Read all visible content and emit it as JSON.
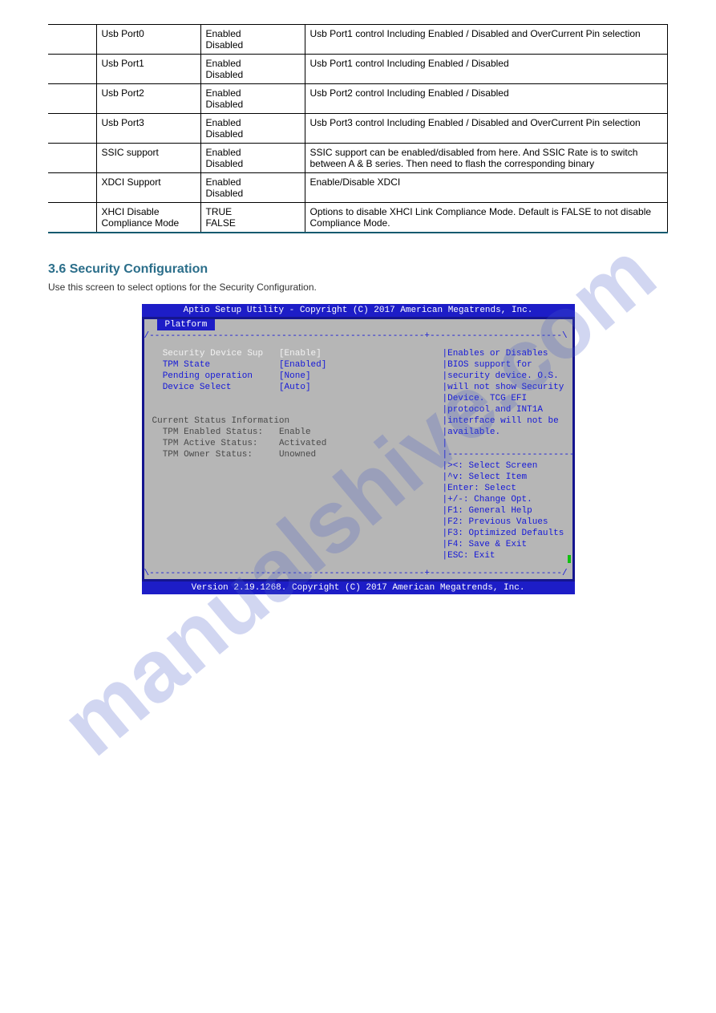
{
  "watermark": "manualshive.com",
  "table": {
    "rows": [
      {
        "c1": "",
        "c2": "Usb Port0",
        "c3": "Enabled\nDisabled",
        "c4": "Usb Port1 control Including Enabled / Disabled and OverCurrent Pin selection"
      },
      {
        "c1": "",
        "c2": "Usb Port1",
        "c3": "Enabled\nDisabled",
        "c4": "Usb Port1 control Including Enabled / Disabled"
      },
      {
        "c1": "",
        "c2": "Usb Port2",
        "c3": "Enabled\nDisabled",
        "c4": "Usb Port2 control Including Enabled / Disabled"
      },
      {
        "c1": "",
        "c2": "Usb Port3",
        "c3": "Enabled\nDisabled",
        "c4": "Usb Port3 control Including Enabled / Disabled and OverCurrent Pin selection"
      },
      {
        "c1": "",
        "c2": "SSIC support",
        "c3": "Enabled\nDisabled",
        "c4": "SSIC support can be enabled/disabled from here. And SSIC Rate is to switch between A & B series. Then need to flash the corresponding binary"
      },
      {
        "c1": "",
        "c2": "XDCI Support",
        "c3": "Enabled\nDisabled",
        "c4": "Enable/Disable XDCI"
      },
      {
        "c1": "",
        "c2": "XHCI Disable Compliance Mode",
        "c3": "TRUE\nFALSE",
        "c4": "Options to disable XHCI Link Compliance Mode. Default is FALSE to not disable Compliance Mode."
      }
    ]
  },
  "heading": "3.6 Security Configuration",
  "subtext": "Use this screen to select options for the Security Configuration.",
  "bios": {
    "header": "Aptio Setup Utility - Copyright (C) 2017 American Megatrends, Inc.",
    "tab": "Platform",
    "footer": "Version 2.19.1268. Copyright (C) 2017 American Megatrends, Inc.",
    "left_options": [
      {
        "label": "Security Device Sup",
        "value": "[Enable]",
        "class": "white"
      },
      {
        "label": "TPM State",
        "value": "[Enabled]",
        "class": "blue"
      },
      {
        "label": "Pending operation",
        "value": "[None]",
        "class": "blue"
      },
      {
        "label": "Device Select",
        "value": "[Auto]",
        "class": "blue"
      }
    ],
    "status_heading": "Current Status Information",
    "status": [
      {
        "label": "TPM Enabled Status:",
        "value": "Enable"
      },
      {
        "label": "TPM Active Status:",
        "value": "Activated"
      },
      {
        "label": "TPM Owner Status:",
        "value": "Unowned"
      }
    ],
    "help": [
      "Enables or Disables",
      "BIOS support for",
      "security device. O.S.",
      "will not show Security",
      "Device. TCG EFI",
      "protocol and INT1A",
      "interface will not be",
      "available."
    ],
    "keys": [
      "><: Select Screen",
      "^v: Select Item",
      "Enter: Select",
      "+/-: Change Opt.",
      "F1: General Help",
      "F2: Previous Values",
      "F3: Optimized Defaults",
      "F4: Save & Exit",
      "ESC: Exit"
    ]
  }
}
